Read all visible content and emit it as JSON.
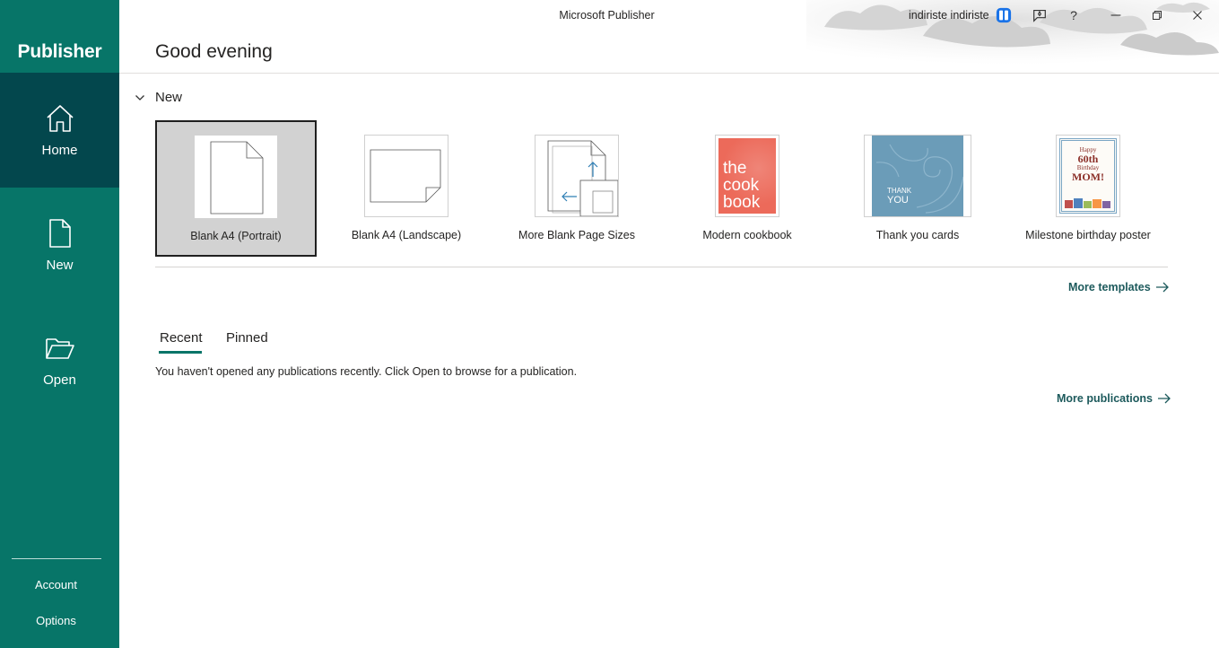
{
  "app": {
    "name": "Publisher",
    "window_title": "Microsoft Publisher"
  },
  "colors": {
    "sidebar": "#077568",
    "sidebar_active": "#03474d",
    "link": "#1d5a5c",
    "cookbook": "#ec6a5a",
    "thankyou": "#6b9cb8"
  },
  "sidebar": {
    "items": [
      {
        "label": "Home",
        "icon": "home-icon",
        "active": true
      },
      {
        "label": "New",
        "icon": "new-document-icon",
        "active": false
      },
      {
        "label": "Open",
        "icon": "folder-open-icon",
        "active": false
      }
    ],
    "bottom": [
      {
        "label": "Account"
      },
      {
        "label": "Options"
      }
    ]
  },
  "titlebar": {
    "user": "indiriste indiriste",
    "icons": [
      "gift-icon",
      "feedback-icon",
      "help-icon",
      "minimize-icon",
      "restore-icon",
      "close-icon"
    ]
  },
  "main": {
    "greeting": "Good evening",
    "new_section": {
      "label": "New",
      "templates": [
        {
          "label": "Blank A4 (Portrait)",
          "selected": true
        },
        {
          "label": "Blank A4 (Landscape)"
        },
        {
          "label": "More Blank Page Sizes"
        },
        {
          "label": "Modern cookbook",
          "text_lines": [
            "the",
            "cook",
            "book"
          ]
        },
        {
          "label": "Thank you cards",
          "text_lines": [
            "THANK",
            "YOU"
          ]
        },
        {
          "label": "Milestone birthday poster",
          "text_lines": [
            "Happy",
            "60th",
            "Birthday",
            "MOM!"
          ]
        }
      ],
      "more_templates": "More templates"
    },
    "tabs": [
      {
        "label": "Recent",
        "active": true
      },
      {
        "label": "Pinned"
      }
    ],
    "empty_message": "You haven't opened any publications recently. Click Open to browse for a publication.",
    "more_publications": "More publications"
  }
}
